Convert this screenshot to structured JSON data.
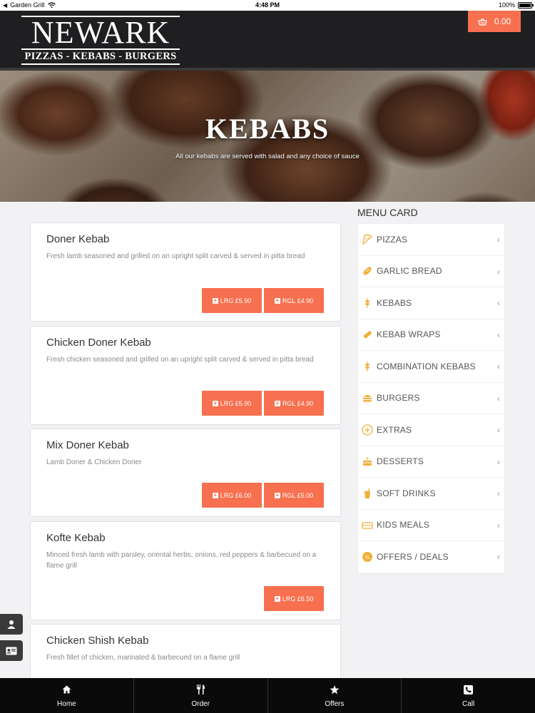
{
  "status_bar": {
    "carrier": "Garden Grill",
    "time": "4:48 PM",
    "battery": "100%"
  },
  "header": {
    "logo_main": "NEWARK",
    "logo_sub": "PIZZAS - KEBABS - BURGERS",
    "cart_total": "0.00"
  },
  "banner": {
    "title": "KEBABS",
    "subtitle": "All our kebabs are served with salad and any choice of sauce"
  },
  "items": [
    {
      "name": "Doner Kebab",
      "desc": "Fresh lamb seasoned and grilled on an upright split carved & served in pitta bread",
      "buttons": [
        "LRG £5.90",
        "RGL £4.90"
      ]
    },
    {
      "name": "Chicken Doner Kebab",
      "desc": "Fresh chicken seasoned and grilled on an upright split carved & served in pitta bread",
      "buttons": [
        "LRG £5.90",
        "RGL £4.90"
      ]
    },
    {
      "name": "Mix Doner Kebab",
      "desc": "Lamb Doner & Chicken Doner",
      "buttons": [
        "LRG £6.00",
        "RGL £5.00"
      ]
    },
    {
      "name": "Kofte Kebab",
      "desc": "Minced fresh lamb with parsley, oriental herbs, onions, red peppers & barbecued on a flame grill",
      "buttons": [
        "LRG £6.50"
      ]
    },
    {
      "name": "Chicken Shish Kebab",
      "desc": "Fresh fillet of chicken, marinated & barbecued on a flame grill",
      "buttons": []
    }
  ],
  "menu_card": {
    "title": "MENU CARD",
    "items": [
      {
        "label": "PIZZAS",
        "icon": "pizza-icon"
      },
      {
        "label": "GARLIC BREAD",
        "icon": "bread-icon"
      },
      {
        "label": "KEBABS",
        "icon": "kebab-icon"
      },
      {
        "label": "KEBAB WRAPS",
        "icon": "wrap-icon"
      },
      {
        "label": "COMBINATION KEBABS",
        "icon": "kebab-icon"
      },
      {
        "label": "BURGERS",
        "icon": "burger-icon"
      },
      {
        "label": "EXTRAS",
        "icon": "plus-circle-icon"
      },
      {
        "label": "DESSERTS",
        "icon": "cake-icon"
      },
      {
        "label": "SOFT DRINKS",
        "icon": "drink-icon"
      },
      {
        "label": "KIDS MEALS",
        "icon": "kids-meal-icon"
      },
      {
        "label": "OFFERS / DEALS",
        "icon": "offer-badge-icon"
      }
    ]
  },
  "bottom_nav": [
    {
      "label": "Home",
      "icon": "home-icon"
    },
    {
      "label": "Order",
      "icon": "cutlery-icon"
    },
    {
      "label": "Offers",
      "icon": "star-icon"
    },
    {
      "label": "Call",
      "icon": "phone-icon"
    }
  ],
  "colors": {
    "accent": "#f7704f",
    "header_bg": "#1f1e20",
    "icon_gold": "#f0b03a"
  }
}
